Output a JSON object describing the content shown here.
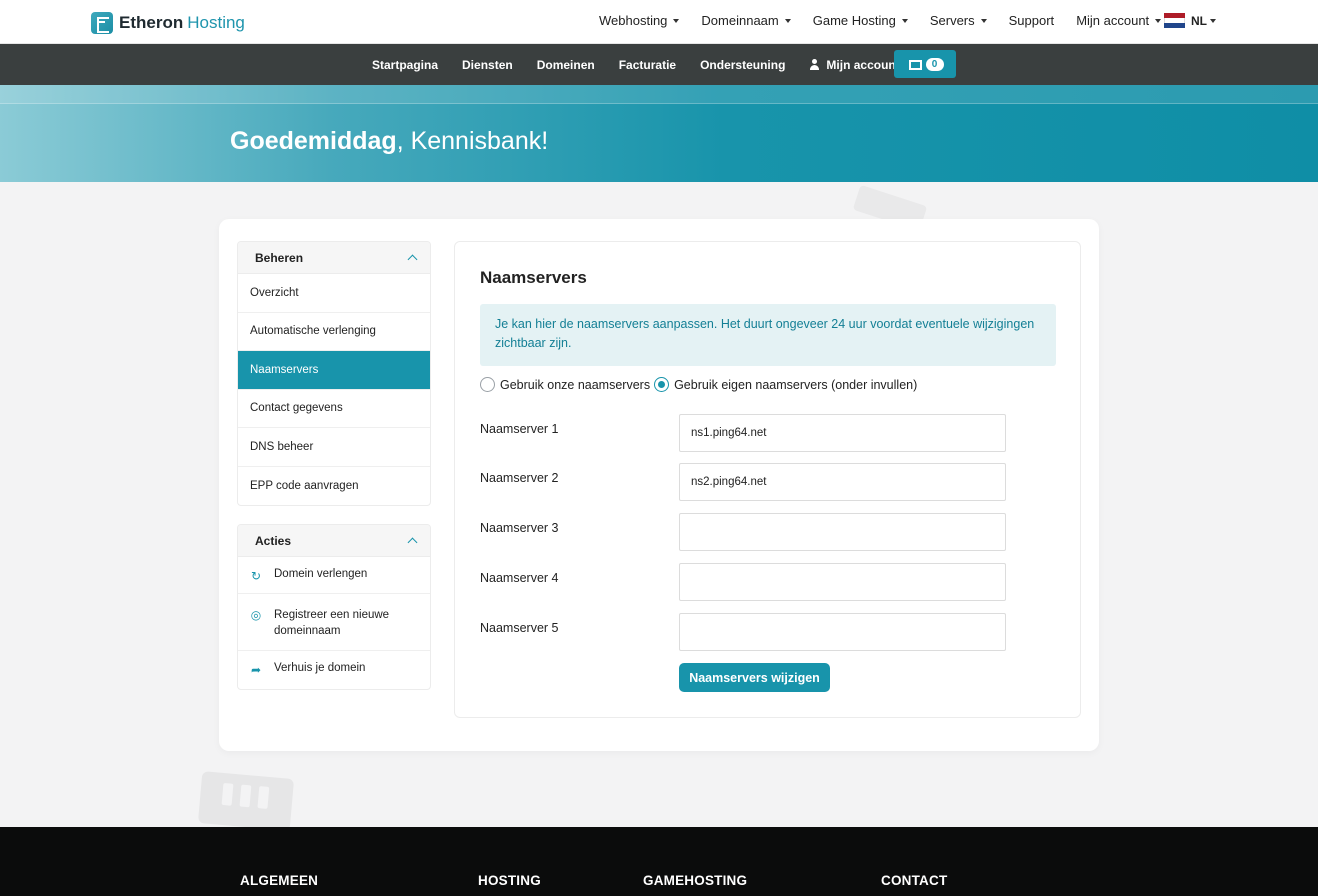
{
  "header": {
    "logo_bold": "Etheron",
    "logo_light": "Hosting",
    "nav": [
      {
        "label": "Webhosting",
        "dropdown": true
      },
      {
        "label": "Domeinnaam",
        "dropdown": true
      },
      {
        "label": "Game Hosting",
        "dropdown": true
      },
      {
        "label": "Servers",
        "dropdown": true
      },
      {
        "label": "Support",
        "dropdown": false
      },
      {
        "label": "Mijn account",
        "dropdown": true
      }
    ],
    "language": "NL"
  },
  "subnav": {
    "items": [
      "Startpagina",
      "Diensten",
      "Domeinen",
      "Facturatie",
      "Ondersteuning"
    ],
    "account_label": "Mijn account",
    "cart_count": "0"
  },
  "hero": {
    "greeting_bold": "Goedemiddag",
    "greeting_rest": ", Kennisbank!"
  },
  "sidebar": {
    "manage": {
      "title": "Beheren",
      "items": [
        "Overzicht",
        "Automatische verlenging",
        "Naamservers",
        "Contact gegevens",
        "DNS beheer",
        "EPP code aanvragen"
      ],
      "active": "Naamservers"
    },
    "actions": {
      "title": "Acties",
      "items": [
        {
          "label": "Domein verlengen",
          "icon": "refresh-icon"
        },
        {
          "label": "Registreer een nieuwe domeinnaam",
          "icon": "globe-icon"
        },
        {
          "label": "Verhuis je domein",
          "icon": "share-arrow-icon"
        }
      ]
    }
  },
  "main": {
    "title": "Naamservers",
    "alert": "Je kan hier de naamservers aanpassen. Het duurt ongeveer 24 uur voordat eventuele wijzigingen zichtbaar zijn.",
    "radio_own": "Gebruik onze naamservers",
    "radio_custom": "Gebruik eigen naamservers (onder invullen)",
    "selected_radio": "custom",
    "fields": [
      {
        "label": "Naamserver 1",
        "value": "ns1.ping64.net"
      },
      {
        "label": "Naamserver 2",
        "value": "ns2.ping64.net"
      },
      {
        "label": "Naamserver 3",
        "value": ""
      },
      {
        "label": "Naamserver 4",
        "value": ""
      },
      {
        "label": "Naamserver 5",
        "value": ""
      }
    ],
    "submit_label": "Naamservers wijzigen"
  },
  "footer": {
    "columns": [
      "ALGEMEEN",
      "HOSTING",
      "GAMEHOSTING",
      "CONTACT"
    ]
  },
  "colors": {
    "accent": "#1894ab",
    "subnav_bg": "#3a3f3f",
    "footer_bg": "#0b0c0c"
  }
}
